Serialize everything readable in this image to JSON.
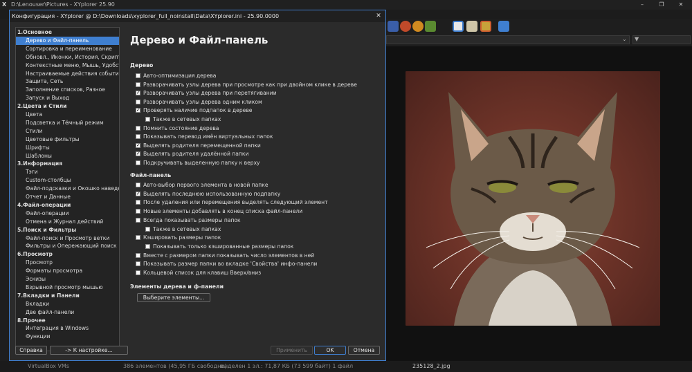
{
  "main_window": {
    "title": "D:\\Lenouser\\Pictures - XYplorer 25.90",
    "logo": "X"
  },
  "addressbar": {
    "chevron": "⌄"
  },
  "statusbar": {
    "items_free": "386 элементов (45,95 ГБ свободно)",
    "selected": "выделен 1 эл.: 71,87 КБ (73 599 байт)   1 файл",
    "tree_item": "VirtualBox VMs",
    "preview_file": "235128_2.jpg"
  },
  "dialog": {
    "title": "Конфигурация - XYplorer @ D:\\Downloads\\xyplorer_full_noinstall\\Data\\XYplorer.ini - 25.90.0000",
    "close": "✕",
    "tree": [
      {
        "label": "1.Основное",
        "header": true
      },
      {
        "label": "Дерево и Файл-панель",
        "selected": true
      },
      {
        "label": "Сортировка и переименование"
      },
      {
        "label": "Обновл., Иконки, История, Скрипты"
      },
      {
        "label": "Контекстные меню, Мышь, Удобства"
      },
      {
        "label": "Настраиваемые действия событий"
      },
      {
        "label": "Защита, Сеть"
      },
      {
        "label": "Заполнение списков, Разное"
      },
      {
        "label": "Запуск и Выход"
      },
      {
        "label": "2.Цвета и Стили",
        "header": true
      },
      {
        "label": "Цвета"
      },
      {
        "label": "Подсветка и Тёмный режим"
      },
      {
        "label": "Стили"
      },
      {
        "label": "Цветовые фильтры"
      },
      {
        "label": "Шрифты"
      },
      {
        "label": "Шаблоны"
      },
      {
        "label": "3.Информация",
        "header": true
      },
      {
        "label": "Тэги"
      },
      {
        "label": "Custom-столбцы"
      },
      {
        "label": "Файл-подсказки и Окошко наведения"
      },
      {
        "label": "Отчет и Данные"
      },
      {
        "label": "4.Файл-операции",
        "header": true
      },
      {
        "label": "Файл-операции"
      },
      {
        "label": "Отмена и Журнал действий"
      },
      {
        "label": "5.Поиск и Фильтры",
        "header": true
      },
      {
        "label": "Файл-поиск и Просмотр ветки"
      },
      {
        "label": "Фильтры и Опережающий поиск"
      },
      {
        "label": "6.Просмотр",
        "header": true
      },
      {
        "label": "Просмотр"
      },
      {
        "label": "Форматы просмотра"
      },
      {
        "label": "Эскизы"
      },
      {
        "label": "Взрывной просмотр мышью"
      },
      {
        "label": "7.Вкладки и Панели",
        "header": true
      },
      {
        "label": "Вкладки"
      },
      {
        "label": "Две файл-панели"
      },
      {
        "label": "8.Прочее",
        "header": true
      },
      {
        "label": "Интеграция в Windows"
      },
      {
        "label": "Функции"
      }
    ],
    "page_title": "Дерево и Файл-панель",
    "section_tree": "Дерево",
    "tree_options": [
      {
        "label": "Авто-оптимизация дерева",
        "checked": false
      },
      {
        "label": "Разворачивать узлы дерева при просмотре как при двойном клике в дереве",
        "checked": false
      },
      {
        "label": "Разворачивать узлы дерева при перетягивании",
        "checked": true
      },
      {
        "label": "Разворачивать узлы дерева одним кликом",
        "checked": false
      },
      {
        "label": "Проверять наличие подпапок в дереве",
        "checked": true
      },
      {
        "label": "Также в сетевых папках",
        "checked": false,
        "indent": true
      },
      {
        "label": "Помнить состояние дерева",
        "checked": false
      },
      {
        "label": "Показывать перевод имён виртуальных папок",
        "checked": false
      },
      {
        "label": "Выделять родителя перемещенной папки",
        "checked": true
      },
      {
        "label": "Выделять родителя удалённой папки",
        "checked": true
      },
      {
        "label": "Подкручивать выделенную папку к верху",
        "checked": false
      }
    ],
    "section_filepane": "Файл-панель",
    "filepane_options": [
      {
        "label": "Авто-выбор первого элемента в новой папке",
        "checked": false
      },
      {
        "label": "Выделять последнюю использованную подпапку",
        "checked": true
      },
      {
        "label": "После удаления или перемещения выделять следующий элемент",
        "checked": false
      },
      {
        "label": "Новые элементы добавлять в конец списка файл-панели",
        "checked": false
      },
      {
        "label": "Всегда показывать размеры папок",
        "checked": false
      },
      {
        "label": "Также в сетевых папках",
        "checked": false,
        "indent": true
      },
      {
        "label": "Кэшировать размеры папок",
        "checked": false
      },
      {
        "label": "Показывать только кэшированные размеры папок",
        "checked": false,
        "indent": true
      },
      {
        "label": "Вместе с размером папки показывать число элементов в ней",
        "checked": false
      },
      {
        "label": "Показывать размер папки во вкладке 'Свойства' инфо-панели",
        "checked": false
      },
      {
        "label": "Кольцевой список для клавиш Вверх/вниз",
        "checked": false
      }
    ],
    "section_elements": "Элементы дерева и ф-панели",
    "choose_elements_button": "Выберите элементы...",
    "buttons": {
      "help": "Справка",
      "to_setting": "-> К настройке...",
      "apply": "Применить",
      "ok": "OK",
      "cancel": "Отмена"
    }
  }
}
